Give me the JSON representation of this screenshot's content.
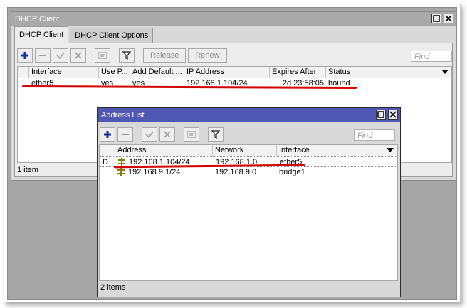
{
  "dhcp_window": {
    "title": "DHCP Client",
    "tabs": [
      "DHCP Client",
      "DHCP Client Options"
    ],
    "toolbar": {
      "release_label": "Release",
      "renew_label": "Renew"
    },
    "find_placeholder": "Find",
    "columns": [
      "Interface",
      "Use P...",
      "Add Default ...",
      "IP Address",
      "Expires After",
      "Status"
    ],
    "rows": [
      {
        "interface": "ether5",
        "use_peer": "yes",
        "add_default": "yes",
        "ip_address": "192.168.1.104/24",
        "expires_after": "2d 23:58:05",
        "status": "bound"
      }
    ],
    "item_count": "1 item"
  },
  "address_window": {
    "title": "Address List",
    "find_placeholder": "Find",
    "columns": [
      "Address",
      "Network",
      "Interface"
    ],
    "rows": [
      {
        "flag": "D",
        "address": "192.168.1.104/24",
        "network": "192.168.1.0",
        "interface": "ether5"
      },
      {
        "flag": "",
        "address": "192.168.9.1/24",
        "network": "192.168.9.0",
        "interface": "bridge1"
      }
    ],
    "item_count": "2 items"
  },
  "colors": {
    "address_title_bar": "#4f59b4",
    "dhcp_title_bar": "#a9a9a9",
    "highlight_underline": "#d30000"
  }
}
